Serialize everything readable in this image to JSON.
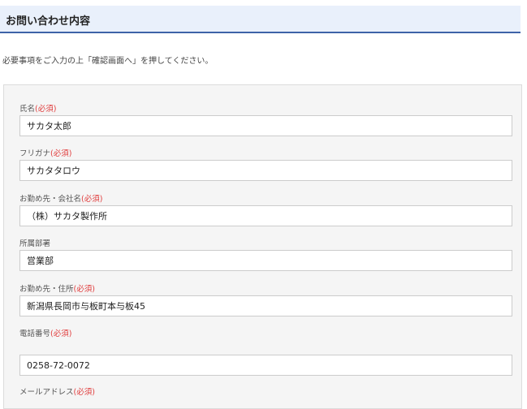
{
  "header": {
    "title": "お問い合わせ内容"
  },
  "intro": {
    "text": "必要事項をご入力の上「確認画面へ」を押してください。"
  },
  "form": {
    "required_mark": "(必須)",
    "fields": [
      {
        "label": "氏名",
        "required": true,
        "value": "サカタ太郎"
      },
      {
        "label": "フリガナ",
        "required": true,
        "value": "サカタタロウ"
      },
      {
        "label": "お勤め先・会社名",
        "required": true,
        "value": "（株）サカタ製作所"
      },
      {
        "label": "所属部署",
        "required": false,
        "value": "営業部"
      },
      {
        "label": "お勤め先・住所",
        "required": true,
        "value": "新潟県長岡市与板町本与板45"
      },
      {
        "label": "電話番号",
        "required": true,
        "value": "0258-72-0072"
      },
      {
        "label": "メールアドレス",
        "required": true,
        "value": ""
      }
    ]
  }
}
